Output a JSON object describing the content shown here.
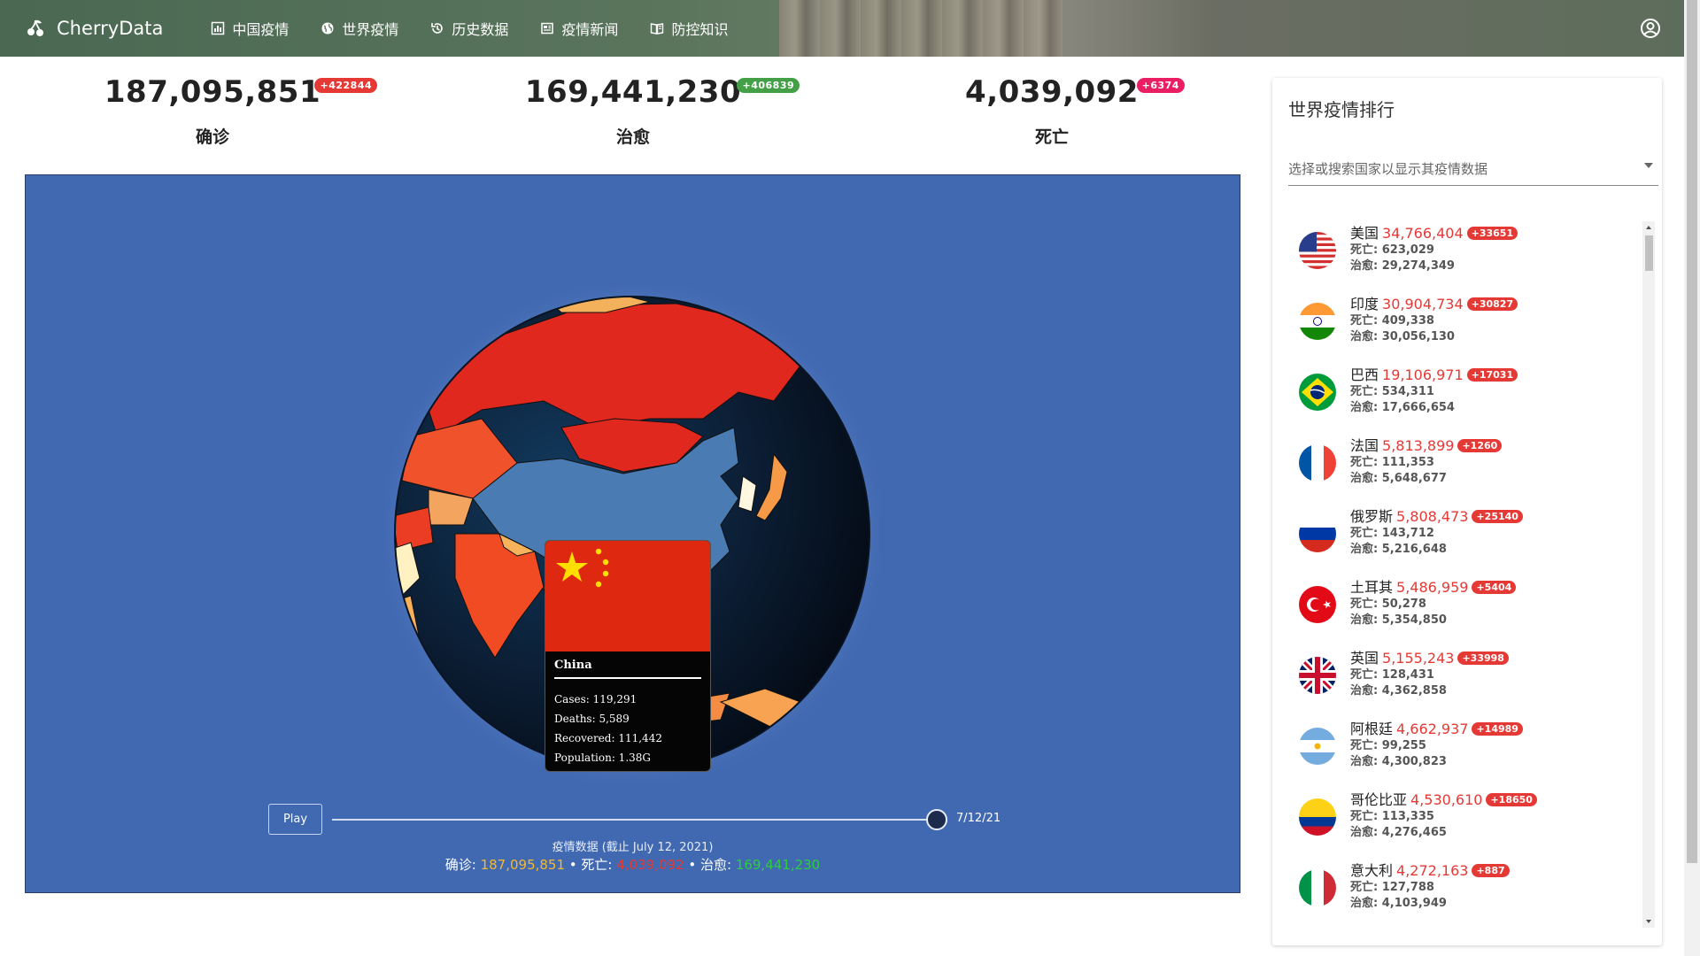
{
  "app": {
    "brand": "CherryData"
  },
  "nav": [
    {
      "label": "中国疫情",
      "icon": "bar-chart-icon"
    },
    {
      "label": "世界疫情",
      "icon": "globe-icon"
    },
    {
      "label": "历史数据",
      "icon": "history-icon"
    },
    {
      "label": "疫情新闻",
      "icon": "newspaper-icon"
    },
    {
      "label": "防控知识",
      "icon": "book-icon"
    }
  ],
  "stats": {
    "confirmed": {
      "value": "187,095,851",
      "increase": "+422844",
      "label": "确诊",
      "color": "#e53935"
    },
    "recovered": {
      "value": "169,441,230",
      "increase": "+406839",
      "label": "治愈",
      "color": "#43a047"
    },
    "deaths": {
      "value": "4,039,092",
      "increase": "+6374",
      "label": "死亡",
      "color": "#e91e63"
    }
  },
  "map": {
    "tooltip": {
      "country": "China",
      "cases": "Cases: 119,291",
      "deaths": "Deaths: 5,589",
      "recovered": "Recovered: 111,442",
      "population": "Population: 1.38G"
    },
    "play_label": "Play",
    "date_label": "7/12/21",
    "slider_progress": 1.0,
    "caption": "疫情数据 (截止 July 12, 2021)",
    "summary": {
      "confirmed_label": "确诊: ",
      "confirmed_value": "187,095,851",
      "sep1": " • ",
      "deaths_label": "死亡: ",
      "deaths_value": "4,039,092",
      "sep2": " • ",
      "recovered_label": "治愈: ",
      "recovered_value": "169,441,230"
    },
    "colors": {
      "background": "#4169b1",
      "confirmed": "#f5b82e",
      "deaths": "#e53935",
      "recovered": "#2ecc40"
    }
  },
  "ranking": {
    "title": "世界疫情排行",
    "search_placeholder": "选择或搜索国家以显示其疫情数据",
    "items": [
      {
        "name": "美国",
        "cases": "34,766,404",
        "increase": "+33651",
        "deaths": "死亡: 623,029",
        "recovered": "治愈: 29,274,349",
        "flag": "us-flag-icon"
      },
      {
        "name": "印度",
        "cases": "30,904,734",
        "increase": "+30827",
        "deaths": "死亡: 409,338",
        "recovered": "治愈: 30,056,130",
        "flag": "india-flag-icon"
      },
      {
        "name": "巴西",
        "cases": "19,106,971",
        "increase": "+17031",
        "deaths": "死亡: 534,311",
        "recovered": "治愈: 17,666,654",
        "flag": "brazil-flag-icon"
      },
      {
        "name": "法国",
        "cases": "5,813,899",
        "increase": "+1260",
        "deaths": "死亡: 111,353",
        "recovered": "治愈: 5,648,677",
        "flag": "france-flag-icon"
      },
      {
        "name": "俄罗斯",
        "cases": "5,808,473",
        "increase": "+25140",
        "deaths": "死亡: 143,712",
        "recovered": "治愈: 5,216,648",
        "flag": "russia-flag-icon"
      },
      {
        "name": "土耳其",
        "cases": "5,486,959",
        "increase": "+5404",
        "deaths": "死亡: 50,278",
        "recovered": "治愈: 5,354,850",
        "flag": "turkey-flag-icon"
      },
      {
        "name": "英国",
        "cases": "5,155,243",
        "increase": "+33998",
        "deaths": "死亡: 128,431",
        "recovered": "治愈: 4,362,858",
        "flag": "uk-flag-icon"
      },
      {
        "name": "阿根廷",
        "cases": "4,662,937",
        "increase": "+14989",
        "deaths": "死亡: 99,255",
        "recovered": "治愈: 4,300,823",
        "flag": "argentina-flag-icon"
      },
      {
        "name": "哥伦比亚",
        "cases": "4,530,610",
        "increase": "+18650",
        "deaths": "死亡: 113,335",
        "recovered": "治愈: 4,276,465",
        "flag": "colombia-flag-icon"
      },
      {
        "name": "意大利",
        "cases": "4,272,163",
        "increase": "+887",
        "deaths": "死亡: 127,788",
        "recovered": "治愈: 4,103,949",
        "flag": "italy-flag-icon"
      }
    ]
  }
}
